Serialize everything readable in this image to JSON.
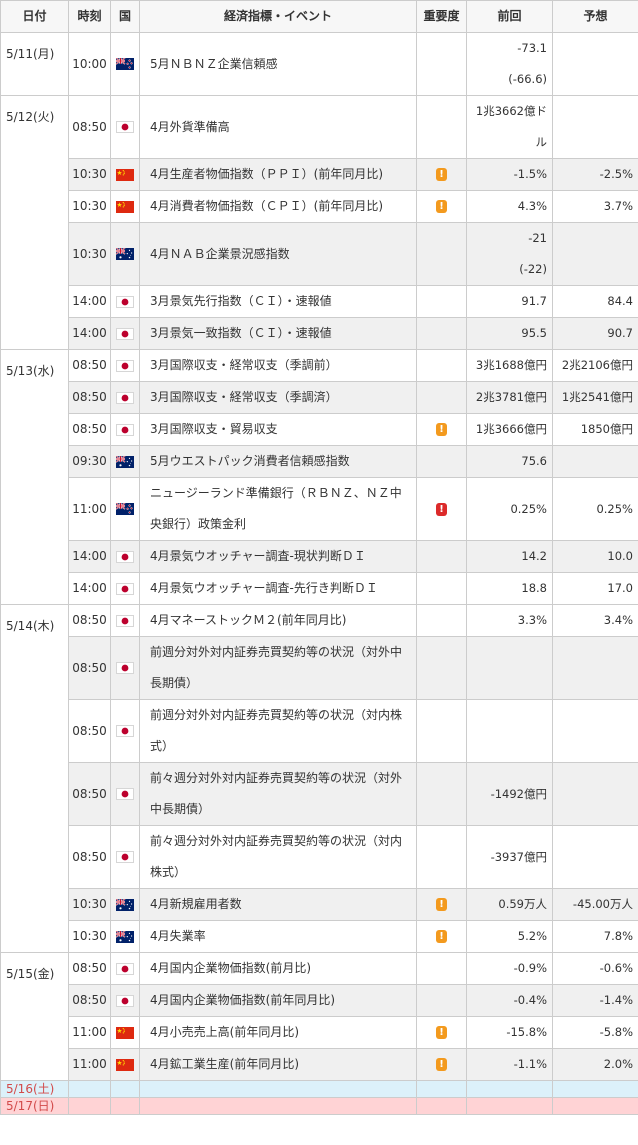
{
  "headers": {
    "date": "日付",
    "time": "時刻",
    "country": "国",
    "event": "経済指標・イベント",
    "importance": "重要度",
    "previous": "前回",
    "forecast": "予想"
  },
  "colors": {
    "border": "#cccccc",
    "row_shade": "#f0f0f0",
    "saturday": "#dcf1fa",
    "sunday": "#ffd3d5",
    "weekend_text": "#d24a4a",
    "importance_mid": "#f39a1e",
    "importance_high": "#dc2a2a"
  },
  "rows": [
    {
      "date": "5/11(月)",
      "time": "10:00",
      "country_icon": "nz-flag-icon",
      "event": "5月ＮＢＮＺ企業信頼感",
      "importance": "",
      "previous": [
        "-73.1",
        "(-66.6)"
      ],
      "forecast": ""
    },
    {
      "date": "5/12(火)",
      "time": "08:50",
      "country_icon": "jp-flag-icon",
      "event": "4月外貨準備高",
      "importance": "",
      "previous": [
        "1兆3662億ド",
        "ル"
      ],
      "forecast": ""
    },
    {
      "date": "",
      "time": "10:30",
      "country_icon": "cn-flag-icon",
      "event": "4月生産者物価指数（ＰＰＩ）(前年同月比)",
      "importance": "mid",
      "previous": "-1.5%",
      "forecast": "-2.5%"
    },
    {
      "date": "",
      "time": "10:30",
      "country_icon": "cn-flag-icon",
      "event": "4月消費者物価指数（ＣＰＩ）(前年同月比)",
      "importance": "mid",
      "previous": "4.3%",
      "forecast": "3.7%"
    },
    {
      "date": "",
      "time": "10:30",
      "country_icon": "au-flag-icon",
      "event": "4月ＮＡＢ企業景況感指数",
      "importance": "",
      "previous": [
        "-21",
        "(-22)"
      ],
      "forecast": ""
    },
    {
      "date": "",
      "time": "14:00",
      "country_icon": "jp-flag-icon",
      "event": "3月景気先行指数（ＣＩ）・速報値",
      "importance": "",
      "previous": "91.7",
      "forecast": "84.4"
    },
    {
      "date": "",
      "time": "14:00",
      "country_icon": "jp-flag-icon",
      "event": "3月景気一致指数（ＣＩ）・速報値",
      "importance": "",
      "previous": "95.5",
      "forecast": "90.7"
    },
    {
      "date": "5/13(水)",
      "time": "08:50",
      "country_icon": "jp-flag-icon",
      "event": "3月国際収支・経常収支（季調前）",
      "importance": "",
      "previous": "3兆1688億円",
      "forecast": "2兆2106億円"
    },
    {
      "date": "",
      "time": "08:50",
      "country_icon": "jp-flag-icon",
      "event": "3月国際収支・経常収支（季調済）",
      "importance": "",
      "previous": "2兆3781億円",
      "forecast": "1兆2541億円"
    },
    {
      "date": "",
      "time": "08:50",
      "country_icon": "jp-flag-icon",
      "event": "3月国際収支・貿易収支",
      "importance": "mid",
      "previous": "1兆3666億円",
      "forecast": "1850億円"
    },
    {
      "date": "",
      "time": "09:30",
      "country_icon": "au-flag-icon",
      "event": "5月ウエストパック消費者信頼感指数",
      "importance": "",
      "previous": "75.6",
      "forecast": ""
    },
    {
      "date": "",
      "time": "11:00",
      "country_icon": "nz-flag-icon",
      "event": [
        "ニュージーランド準備銀行（ＲＢＮＺ、ＮＺ中",
        "央銀行）政策金利"
      ],
      "importance": "high",
      "previous": "0.25%",
      "forecast": "0.25%"
    },
    {
      "date": "",
      "time": "14:00",
      "country_icon": "jp-flag-icon",
      "event": "4月景気ウオッチャー調査-現状判断ＤＩ",
      "importance": "",
      "previous": "14.2",
      "forecast": "10.0"
    },
    {
      "date": "",
      "time": "14:00",
      "country_icon": "jp-flag-icon",
      "event": "4月景気ウオッチャー調査-先行き判断ＤＩ",
      "importance": "",
      "previous": "18.8",
      "forecast": "17.0"
    },
    {
      "date": "5/14(木)",
      "time": "08:50",
      "country_icon": "jp-flag-icon",
      "event": "4月マネーストックＭ２(前年同月比)",
      "importance": "",
      "previous": "3.3%",
      "forecast": "3.4%"
    },
    {
      "date": "",
      "time": "08:50",
      "country_icon": "jp-flag-icon",
      "event": [
        "前週分対外対内証券売買契約等の状況（対外中",
        "長期債）"
      ],
      "importance": "",
      "previous": "",
      "forecast": ""
    },
    {
      "date": "",
      "time": "08:50",
      "country_icon": "jp-flag-icon",
      "event": [
        "前週分対外対内証券売買契約等の状況（対内株",
        "式）"
      ],
      "importance": "",
      "previous": "",
      "forecast": ""
    },
    {
      "date": "",
      "time": "08:50",
      "country_icon": "jp-flag-icon",
      "event": [
        "前々週分対外対内証券売買契約等の状況（対外",
        "中長期債）"
      ],
      "importance": "",
      "previous": "-1492億円",
      "forecast": ""
    },
    {
      "date": "",
      "time": "08:50",
      "country_icon": "jp-flag-icon",
      "event": [
        "前々週分対外対内証券売買契約等の状況（対内",
        "株式）"
      ],
      "importance": "",
      "previous": "-3937億円",
      "forecast": ""
    },
    {
      "date": "",
      "time": "10:30",
      "country_icon": "au-flag-icon",
      "event": "4月新規雇用者数",
      "importance": "mid",
      "previous": "0.59万人",
      "forecast": "-45.00万人"
    },
    {
      "date": "",
      "time": "10:30",
      "country_icon": "au-flag-icon",
      "event": "4月失業率",
      "importance": "mid",
      "previous": "5.2%",
      "forecast": "7.8%"
    },
    {
      "date": "5/15(金)",
      "time": "08:50",
      "country_icon": "jp-flag-icon",
      "event": "4月国内企業物価指数(前月比)",
      "importance": "",
      "previous": "-0.9%",
      "forecast": "-0.6%"
    },
    {
      "date": "",
      "time": "08:50",
      "country_icon": "jp-flag-icon",
      "event": "4月国内企業物価指数(前年同月比)",
      "importance": "",
      "previous": "-0.4%",
      "forecast": "-1.4%"
    },
    {
      "date": "",
      "time": "11:00",
      "country_icon": "cn-flag-icon",
      "event": "4月小売売上高(前年同月比)",
      "importance": "mid",
      "previous": "-15.8%",
      "forecast": "-5.8%"
    },
    {
      "date": "",
      "time": "11:00",
      "country_icon": "cn-flag-icon",
      "event": "4月鉱工業生産(前年同月比)",
      "importance": "mid",
      "previous": "-1.1%",
      "forecast": "2.0%"
    }
  ],
  "weekend": [
    {
      "date": "5/16(土)",
      "kind": "saturday"
    },
    {
      "date": "5/17(日)",
      "kind": "sunday"
    }
  ]
}
